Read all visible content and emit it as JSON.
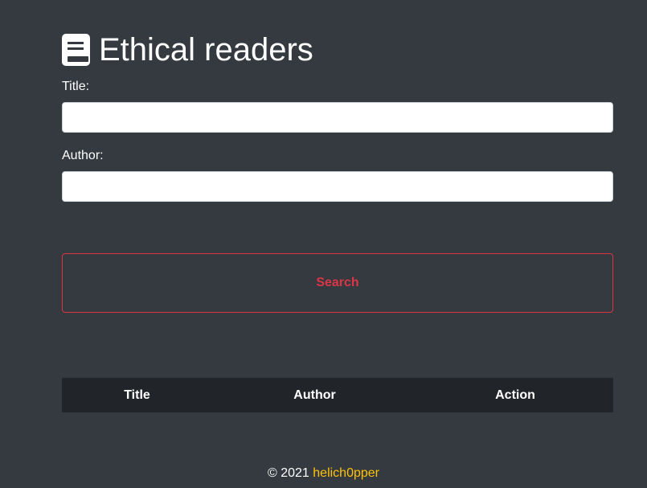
{
  "app": {
    "title": "Ethical readers",
    "icon": "book-icon"
  },
  "form": {
    "title_label": "Title:",
    "title_value": "",
    "author_label": "Author:",
    "author_value": "",
    "search_label": "Search"
  },
  "table": {
    "columns": [
      "Title",
      "Author",
      "Action"
    ],
    "rows": []
  },
  "footer": {
    "copyright": "© 2021",
    "author": "helich0pper"
  },
  "colors": {
    "background": "#343a40",
    "danger": "#dc3545",
    "link": "#ffc107",
    "table_header": "#212529"
  }
}
